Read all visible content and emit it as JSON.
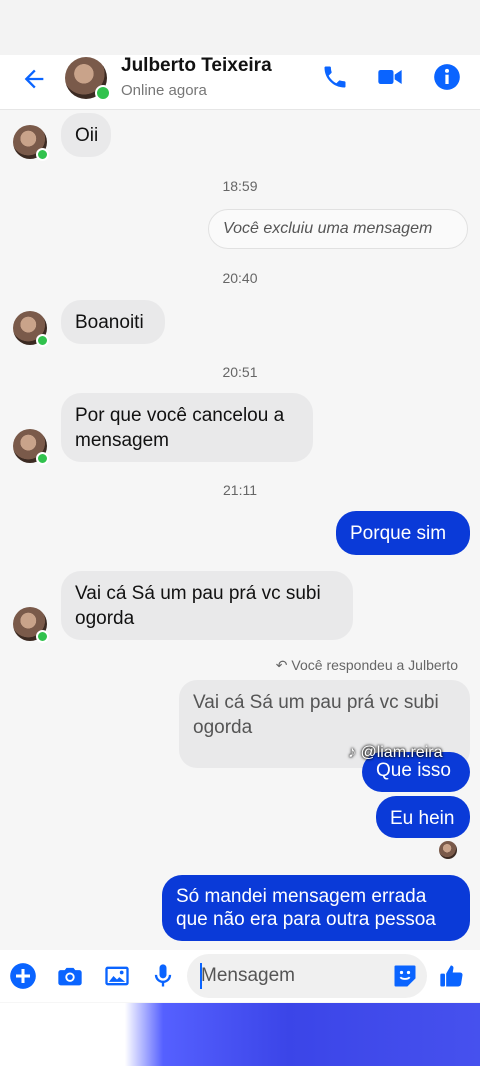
{
  "header": {
    "contact_name": "Julberto Teixeira",
    "status": "Online agora"
  },
  "messages": {
    "m1": "Oii",
    "t1": "18:59",
    "deleted_notice": "Você excluiu uma mensagem",
    "t2": "20:40",
    "m2": "Boanoiti",
    "t3": "20:51",
    "m3": "Por que você cancelou a mensagem",
    "t4": "21:11",
    "m4": "Porque sim",
    "m5": "Vai cá Sá um pau prá vc subi ogorda",
    "reply_label": "Você respondeu a Julberto",
    "reply_quote": "Vai cá Sá um pau prá vc subi ogorda",
    "m6": "Que isso",
    "m7": "Eu hein",
    "m8": "Só mandei mensagem errada que não era para outra pessoa"
  },
  "overlay": {
    "watermark": "@liam.reira"
  },
  "composer": {
    "placeholder": "Mensagem"
  },
  "colors": {
    "accent": "#0a64ff",
    "outgoing_bubble": "#0a3ad8",
    "incoming_bubble": "#e9e9ea",
    "online_dot": "#31c24d"
  }
}
